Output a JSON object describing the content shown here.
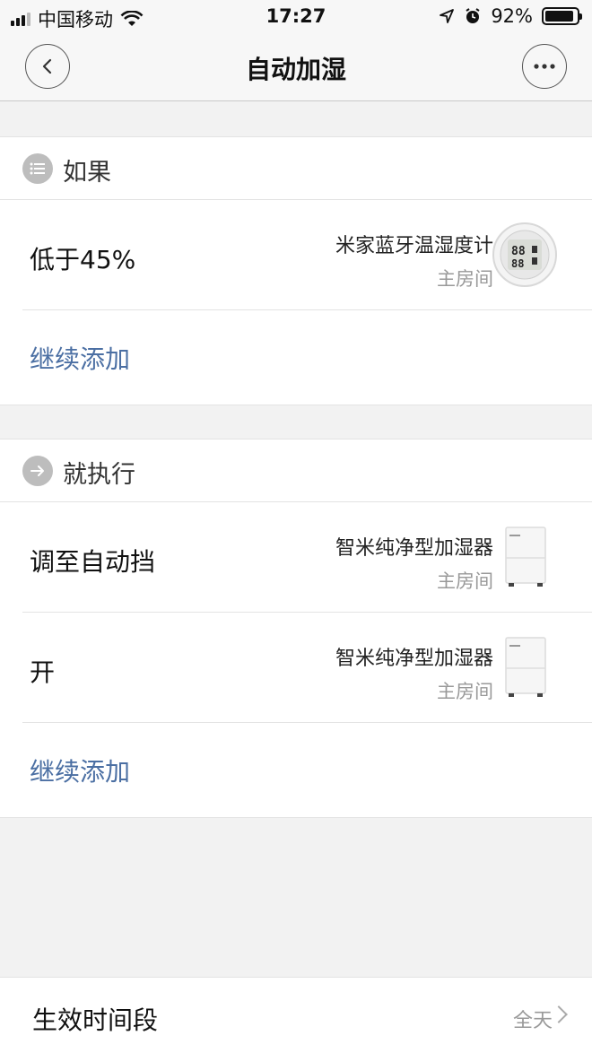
{
  "status_bar": {
    "carrier": "中国移动",
    "time": "17:27",
    "battery": "92%",
    "battery_level": 0.92
  },
  "nav": {
    "title": "自动加湿"
  },
  "if_section": {
    "header": "如果",
    "header_icon": "list-icon",
    "conditions": [
      {
        "label": "低于45%",
        "device_name": "米家蓝牙温湿度计",
        "room": "主房间",
        "device_image": "thermo-hygrometer"
      }
    ],
    "add_label": "继续添加"
  },
  "then_section": {
    "header": "就执行",
    "header_icon": "arrow-right-icon",
    "actions": [
      {
        "label": "调至自动挡",
        "device_name": "智米纯净型加湿器",
        "room": "主房间",
        "device_image": "humidifier"
      },
      {
        "label": "开",
        "device_name": "智米纯净型加湿器",
        "room": "主房间",
        "device_image": "humidifier"
      }
    ],
    "add_label": "继续添加"
  },
  "schedule": {
    "label": "生效时间段",
    "value": "全天"
  },
  "colors": {
    "link": "#4b6fa3",
    "background": "#f2f2f2"
  }
}
